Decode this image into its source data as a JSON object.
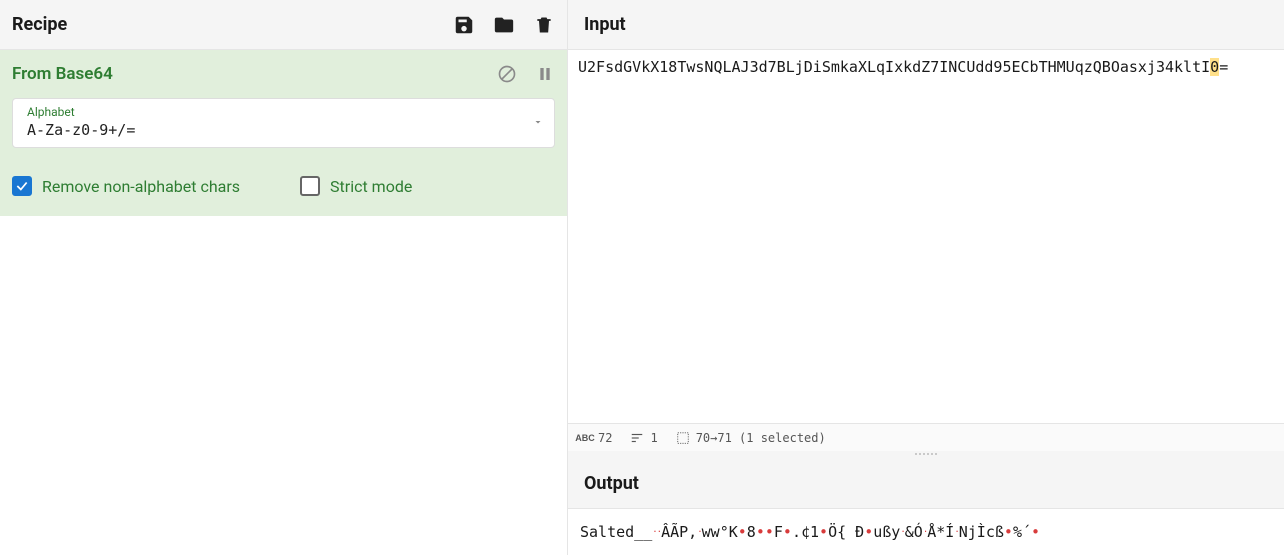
{
  "recipe": {
    "title": "Recipe",
    "operation": {
      "name": "From Base64",
      "alphabet_label": "Alphabet",
      "alphabet_value": "A-Za-z0-9+/=",
      "remove_non_alpha_label": "Remove non-alphabet chars",
      "remove_non_alpha_checked": true,
      "strict_mode_label": "Strict mode",
      "strict_mode_checked": false
    }
  },
  "input": {
    "title": "Input",
    "text_before": "U2FsdGVkX18TwsNQLAJ3d7BLjDiSmkaXLqIxkdZ7INCUdd95ECbTHMUqzQBOasxj34kltI",
    "highlighted": "0",
    "text_after": "="
  },
  "statusbar": {
    "length": "72",
    "lines": "1",
    "selection": "70→71 (1 selected)"
  },
  "output": {
    "title": "Output",
    "segments": [
      {
        "t": "Salted__",
        "c": "plain"
      },
      {
        "t": "··",
        "c": "ctrl"
      },
      {
        "t": "ÂÃP,",
        "c": "plain"
      },
      {
        "t": "·",
        "c": "ctrl"
      },
      {
        "t": "ww°K",
        "c": "plain"
      },
      {
        "t": "•",
        "c": "dot"
      },
      {
        "t": "8",
        "c": "plain"
      },
      {
        "t": "••",
        "c": "dot"
      },
      {
        "t": "F",
        "c": "plain"
      },
      {
        "t": "•",
        "c": "dot"
      },
      {
        "t": ".¢1",
        "c": "plain"
      },
      {
        "t": "•",
        "c": "dot"
      },
      {
        "t": "Ö{ Ð",
        "c": "plain"
      },
      {
        "t": "•",
        "c": "dot"
      },
      {
        "t": "ußy",
        "c": "plain"
      },
      {
        "t": "·",
        "c": "ctrl"
      },
      {
        "t": "&Ó",
        "c": "plain"
      },
      {
        "t": "·",
        "c": "ctrl"
      },
      {
        "t": "Å*Í",
        "c": "plain"
      },
      {
        "t": "·",
        "c": "ctrl"
      },
      {
        "t": "NjÌcß",
        "c": "plain"
      },
      {
        "t": "•",
        "c": "dot"
      },
      {
        "t": "%´",
        "c": "plain"
      },
      {
        "t": "•",
        "c": "dot"
      }
    ]
  }
}
